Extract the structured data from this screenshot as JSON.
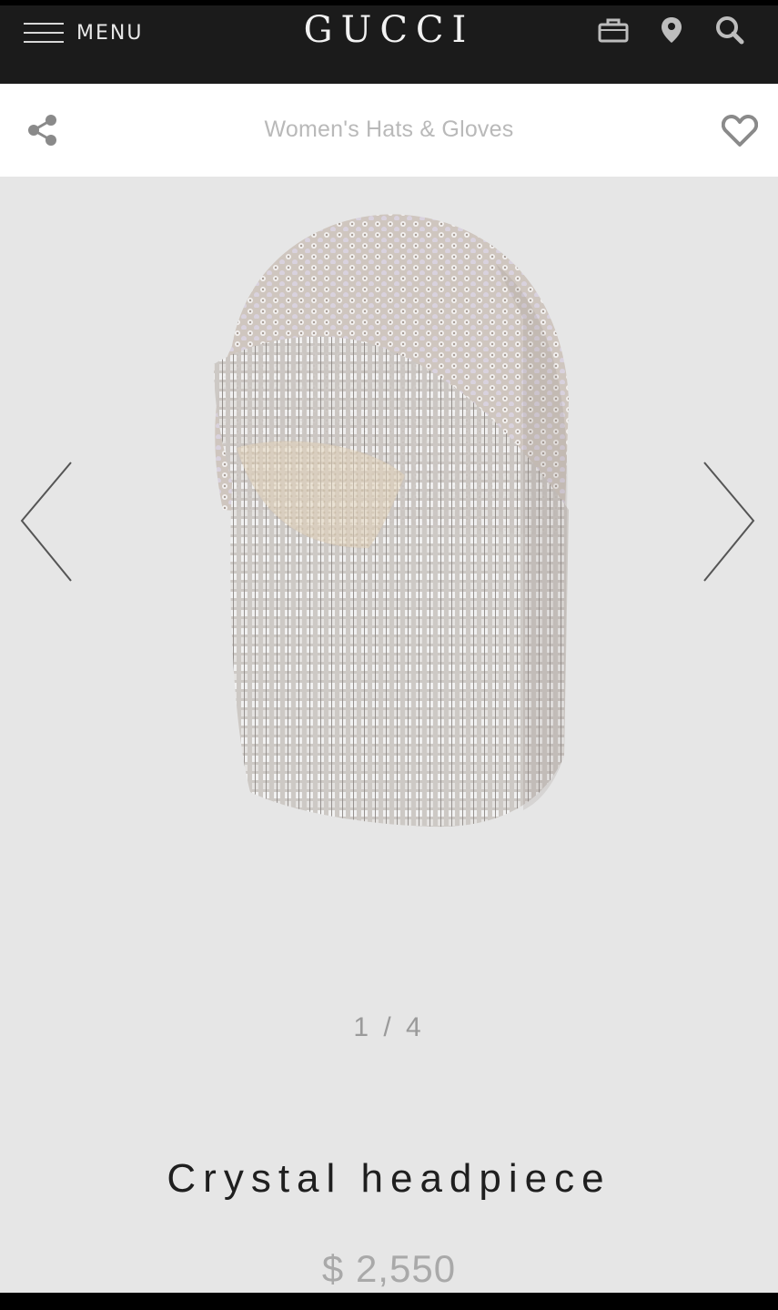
{
  "header": {
    "menu_label": "MENU",
    "brand": "GUCCI",
    "icons": [
      "menu-icon",
      "shopping-bag-icon",
      "location-pin-icon",
      "search-icon"
    ]
  },
  "subheader": {
    "category": "Women's Hats & Gloves",
    "icons": [
      "share-icon",
      "heart-icon"
    ]
  },
  "gallery": {
    "pager": "1 / 4",
    "icons": [
      "chevron-left-icon",
      "chevron-right-icon"
    ]
  },
  "product": {
    "name": "Crystal headpiece",
    "price": "$ 2,550"
  },
  "colors": {
    "topbar": "#1b1b1b",
    "page_bg": "#e6e6e6",
    "subheader_bg": "#ffffff",
    "muted_text": "#a9a9a9",
    "title_text": "#1f1f1f"
  }
}
